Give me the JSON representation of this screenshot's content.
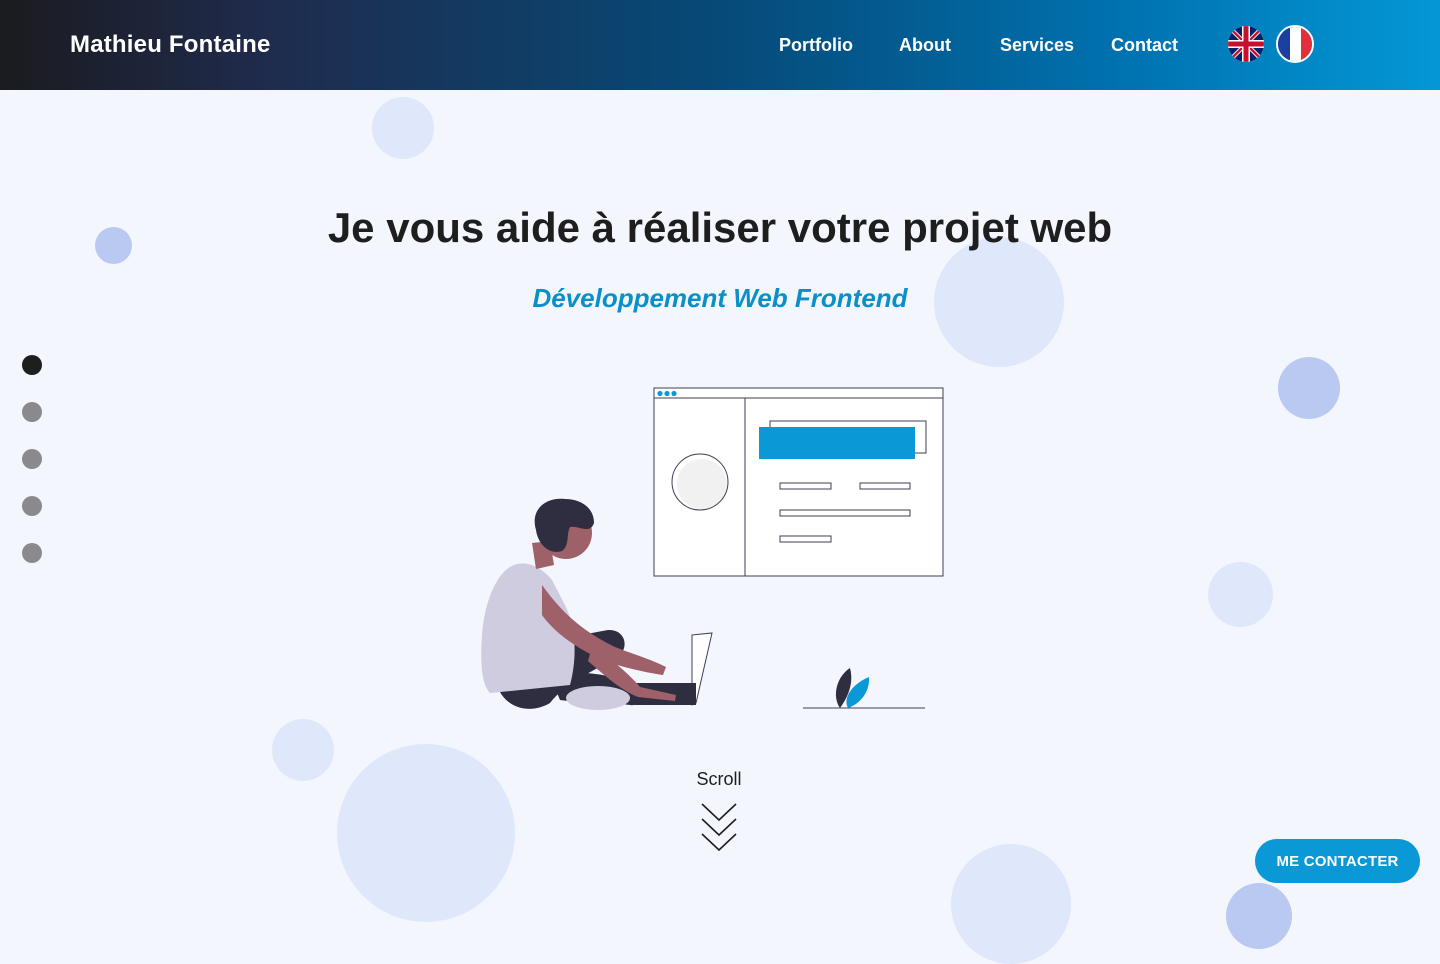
{
  "header": {
    "brand": "Mathieu Fontaine",
    "nav": [
      {
        "label": "Portfolio"
      },
      {
        "label": "About"
      },
      {
        "label": "Services"
      },
      {
        "label": "Contact"
      }
    ],
    "languages": [
      {
        "icon": "uk-flag-icon",
        "name": "English"
      },
      {
        "icon": "france-flag-icon",
        "name": "Français"
      }
    ]
  },
  "hero": {
    "title": "Je vous aide à réaliser votre projet web",
    "subtitle": "Développement Web Frontend",
    "scroll_label": "Scroll"
  },
  "section_dots": {
    "count": 5,
    "active_index": 0
  },
  "cta": {
    "label": "ME CONTACTER"
  },
  "colors": {
    "accent": "#0a98d6",
    "subtitle": "#0a90c8",
    "page_bg": "#f4f6fe",
    "bubble_light": "#dfe7fa",
    "bubble_mid": "#b9c9f2",
    "dot_active": "#1e1e1e",
    "dot_inactive": "#8a8a8e"
  }
}
